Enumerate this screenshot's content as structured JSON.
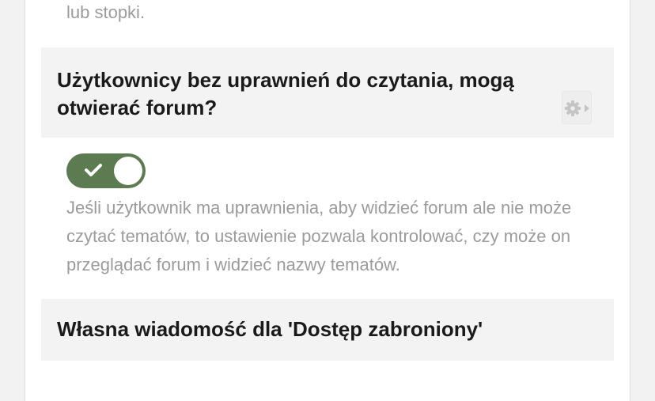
{
  "previous_setting": {
    "description_tail": "lub stopki."
  },
  "settings": [
    {
      "title": "Użytkownicy bez uprawnień do czytania, mogą otwierać forum?",
      "toggle_enabled": true,
      "description": "Jeśli użytkownik ma uprawnienia, aby widzieć forum ale nie może czytać tematów, to ustawienie pozwala kontrolować, czy może on przeglądać forum i widzieć nazwy tematów."
    },
    {
      "title": "Własna wiadomość dla 'Dostęp zabroniony'"
    }
  ],
  "icons": {
    "settings_menu": "gear-icon",
    "settings_menu_arrow": "caret-right-icon",
    "toggle_on": "checkmark-icon"
  },
  "colors": {
    "toggle_on": "#5d7b51",
    "header_background": "#f3f3f3",
    "description_text": "#9b9b9b",
    "title_text": "#1a1a1a"
  }
}
